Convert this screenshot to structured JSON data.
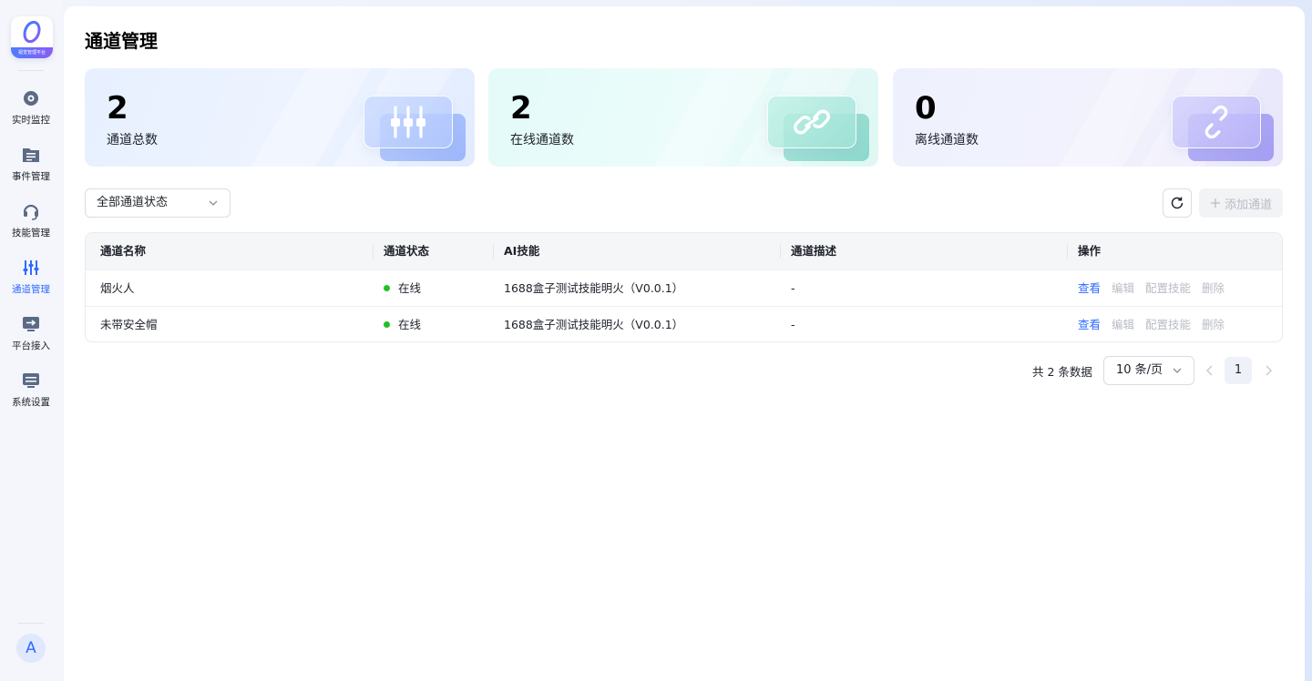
{
  "app": {
    "logo_text": "视觉管理平台",
    "avatar_letter": "A"
  },
  "sidebar": {
    "items": [
      {
        "label": "实时监控",
        "icon": "monitor-camera-icon"
      },
      {
        "label": "事件管理",
        "icon": "event-list-icon"
      },
      {
        "label": "技能管理",
        "icon": "skill-headset-icon"
      },
      {
        "label": "通道管理",
        "icon": "channel-sliders-icon",
        "active": true
      },
      {
        "label": "平台接入",
        "icon": "platform-access-icon"
      },
      {
        "label": "系统设置",
        "icon": "settings-panel-icon"
      }
    ]
  },
  "page": {
    "title": "通道管理"
  },
  "stats": [
    {
      "value": "2",
      "label": "通道总数",
      "icon": "sliders-icon"
    },
    {
      "value": "2",
      "label": "在线通道数",
      "icon": "link-icon"
    },
    {
      "value": "0",
      "label": "离线通道数",
      "icon": "broken-link-icon"
    }
  ],
  "toolbar": {
    "filter_value": "全部通道状态",
    "add_label": "添加通道"
  },
  "table": {
    "headers": [
      "通道名称",
      "通道状态",
      "AI技能",
      "通道描述",
      "操作"
    ],
    "rows": [
      {
        "name": "烟火人",
        "status": "在线",
        "skill": "1688盒子测试技能明火（V0.0.1）",
        "desc": "-"
      },
      {
        "name": "未带安全帽",
        "status": "在线",
        "skill": "1688盒子测试技能明火（V0.0.1）",
        "desc": "-"
      }
    ],
    "actions": {
      "view": "查看",
      "edit": "编辑",
      "config": "配置技能",
      "delete": "删除"
    }
  },
  "pagination": {
    "total_text": "共 2 条数据",
    "page_size": "10 条/页",
    "current_page": "1"
  },
  "colors": {
    "accent": "#2f6bff",
    "online": "#20c223",
    "disabled": "#b8bcc4"
  }
}
